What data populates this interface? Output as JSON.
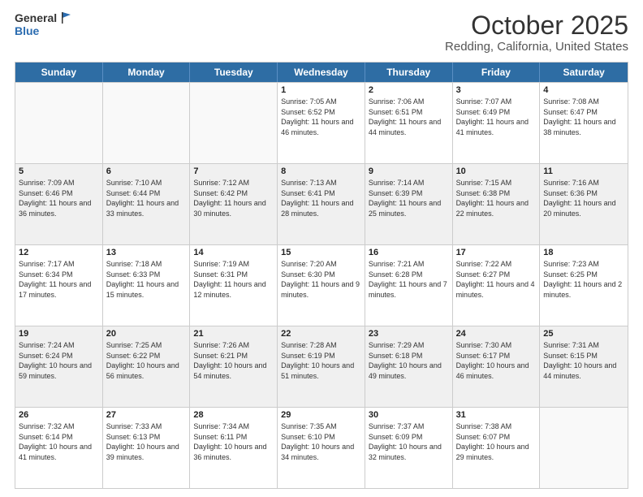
{
  "logo": {
    "general": "General",
    "blue": "Blue"
  },
  "title": "October 2025",
  "subtitle": "Redding, California, United States",
  "days_of_week": [
    "Sunday",
    "Monday",
    "Tuesday",
    "Wednesday",
    "Thursday",
    "Friday",
    "Saturday"
  ],
  "weeks": [
    [
      {
        "day": "",
        "sunrise": "",
        "sunset": "",
        "daylight": "",
        "empty": true
      },
      {
        "day": "",
        "sunrise": "",
        "sunset": "",
        "daylight": "",
        "empty": true
      },
      {
        "day": "",
        "sunrise": "",
        "sunset": "",
        "daylight": "",
        "empty": true
      },
      {
        "day": "1",
        "sunrise": "Sunrise: 7:05 AM",
        "sunset": "Sunset: 6:52 PM",
        "daylight": "Daylight: 11 hours and 46 minutes."
      },
      {
        "day": "2",
        "sunrise": "Sunrise: 7:06 AM",
        "sunset": "Sunset: 6:51 PM",
        "daylight": "Daylight: 11 hours and 44 minutes."
      },
      {
        "day": "3",
        "sunrise": "Sunrise: 7:07 AM",
        "sunset": "Sunset: 6:49 PM",
        "daylight": "Daylight: 11 hours and 41 minutes."
      },
      {
        "day": "4",
        "sunrise": "Sunrise: 7:08 AM",
        "sunset": "Sunset: 6:47 PM",
        "daylight": "Daylight: 11 hours and 38 minutes."
      }
    ],
    [
      {
        "day": "5",
        "sunrise": "Sunrise: 7:09 AM",
        "sunset": "Sunset: 6:46 PM",
        "daylight": "Daylight: 11 hours and 36 minutes."
      },
      {
        "day": "6",
        "sunrise": "Sunrise: 7:10 AM",
        "sunset": "Sunset: 6:44 PM",
        "daylight": "Daylight: 11 hours and 33 minutes."
      },
      {
        "day": "7",
        "sunrise": "Sunrise: 7:12 AM",
        "sunset": "Sunset: 6:42 PM",
        "daylight": "Daylight: 11 hours and 30 minutes."
      },
      {
        "day": "8",
        "sunrise": "Sunrise: 7:13 AM",
        "sunset": "Sunset: 6:41 PM",
        "daylight": "Daylight: 11 hours and 28 minutes."
      },
      {
        "day": "9",
        "sunrise": "Sunrise: 7:14 AM",
        "sunset": "Sunset: 6:39 PM",
        "daylight": "Daylight: 11 hours and 25 minutes."
      },
      {
        "day": "10",
        "sunrise": "Sunrise: 7:15 AM",
        "sunset": "Sunset: 6:38 PM",
        "daylight": "Daylight: 11 hours and 22 minutes."
      },
      {
        "day": "11",
        "sunrise": "Sunrise: 7:16 AM",
        "sunset": "Sunset: 6:36 PM",
        "daylight": "Daylight: 11 hours and 20 minutes."
      }
    ],
    [
      {
        "day": "12",
        "sunrise": "Sunrise: 7:17 AM",
        "sunset": "Sunset: 6:34 PM",
        "daylight": "Daylight: 11 hours and 17 minutes."
      },
      {
        "day": "13",
        "sunrise": "Sunrise: 7:18 AM",
        "sunset": "Sunset: 6:33 PM",
        "daylight": "Daylight: 11 hours and 15 minutes."
      },
      {
        "day": "14",
        "sunrise": "Sunrise: 7:19 AM",
        "sunset": "Sunset: 6:31 PM",
        "daylight": "Daylight: 11 hours and 12 minutes."
      },
      {
        "day": "15",
        "sunrise": "Sunrise: 7:20 AM",
        "sunset": "Sunset: 6:30 PM",
        "daylight": "Daylight: 11 hours and 9 minutes."
      },
      {
        "day": "16",
        "sunrise": "Sunrise: 7:21 AM",
        "sunset": "Sunset: 6:28 PM",
        "daylight": "Daylight: 11 hours and 7 minutes."
      },
      {
        "day": "17",
        "sunrise": "Sunrise: 7:22 AM",
        "sunset": "Sunset: 6:27 PM",
        "daylight": "Daylight: 11 hours and 4 minutes."
      },
      {
        "day": "18",
        "sunrise": "Sunrise: 7:23 AM",
        "sunset": "Sunset: 6:25 PM",
        "daylight": "Daylight: 11 hours and 2 minutes."
      }
    ],
    [
      {
        "day": "19",
        "sunrise": "Sunrise: 7:24 AM",
        "sunset": "Sunset: 6:24 PM",
        "daylight": "Daylight: 10 hours and 59 minutes."
      },
      {
        "day": "20",
        "sunrise": "Sunrise: 7:25 AM",
        "sunset": "Sunset: 6:22 PM",
        "daylight": "Daylight: 10 hours and 56 minutes."
      },
      {
        "day": "21",
        "sunrise": "Sunrise: 7:26 AM",
        "sunset": "Sunset: 6:21 PM",
        "daylight": "Daylight: 10 hours and 54 minutes."
      },
      {
        "day": "22",
        "sunrise": "Sunrise: 7:28 AM",
        "sunset": "Sunset: 6:19 PM",
        "daylight": "Daylight: 10 hours and 51 minutes."
      },
      {
        "day": "23",
        "sunrise": "Sunrise: 7:29 AM",
        "sunset": "Sunset: 6:18 PM",
        "daylight": "Daylight: 10 hours and 49 minutes."
      },
      {
        "day": "24",
        "sunrise": "Sunrise: 7:30 AM",
        "sunset": "Sunset: 6:17 PM",
        "daylight": "Daylight: 10 hours and 46 minutes."
      },
      {
        "day": "25",
        "sunrise": "Sunrise: 7:31 AM",
        "sunset": "Sunset: 6:15 PM",
        "daylight": "Daylight: 10 hours and 44 minutes."
      }
    ],
    [
      {
        "day": "26",
        "sunrise": "Sunrise: 7:32 AM",
        "sunset": "Sunset: 6:14 PM",
        "daylight": "Daylight: 10 hours and 41 minutes."
      },
      {
        "day": "27",
        "sunrise": "Sunrise: 7:33 AM",
        "sunset": "Sunset: 6:13 PM",
        "daylight": "Daylight: 10 hours and 39 minutes."
      },
      {
        "day": "28",
        "sunrise": "Sunrise: 7:34 AM",
        "sunset": "Sunset: 6:11 PM",
        "daylight": "Daylight: 10 hours and 36 minutes."
      },
      {
        "day": "29",
        "sunrise": "Sunrise: 7:35 AM",
        "sunset": "Sunset: 6:10 PM",
        "daylight": "Daylight: 10 hours and 34 minutes."
      },
      {
        "day": "30",
        "sunrise": "Sunrise: 7:37 AM",
        "sunset": "Sunset: 6:09 PM",
        "daylight": "Daylight: 10 hours and 32 minutes."
      },
      {
        "day": "31",
        "sunrise": "Sunrise: 7:38 AM",
        "sunset": "Sunset: 6:07 PM",
        "daylight": "Daylight: 10 hours and 29 minutes."
      },
      {
        "day": "",
        "sunrise": "",
        "sunset": "",
        "daylight": "",
        "empty": true
      }
    ]
  ]
}
